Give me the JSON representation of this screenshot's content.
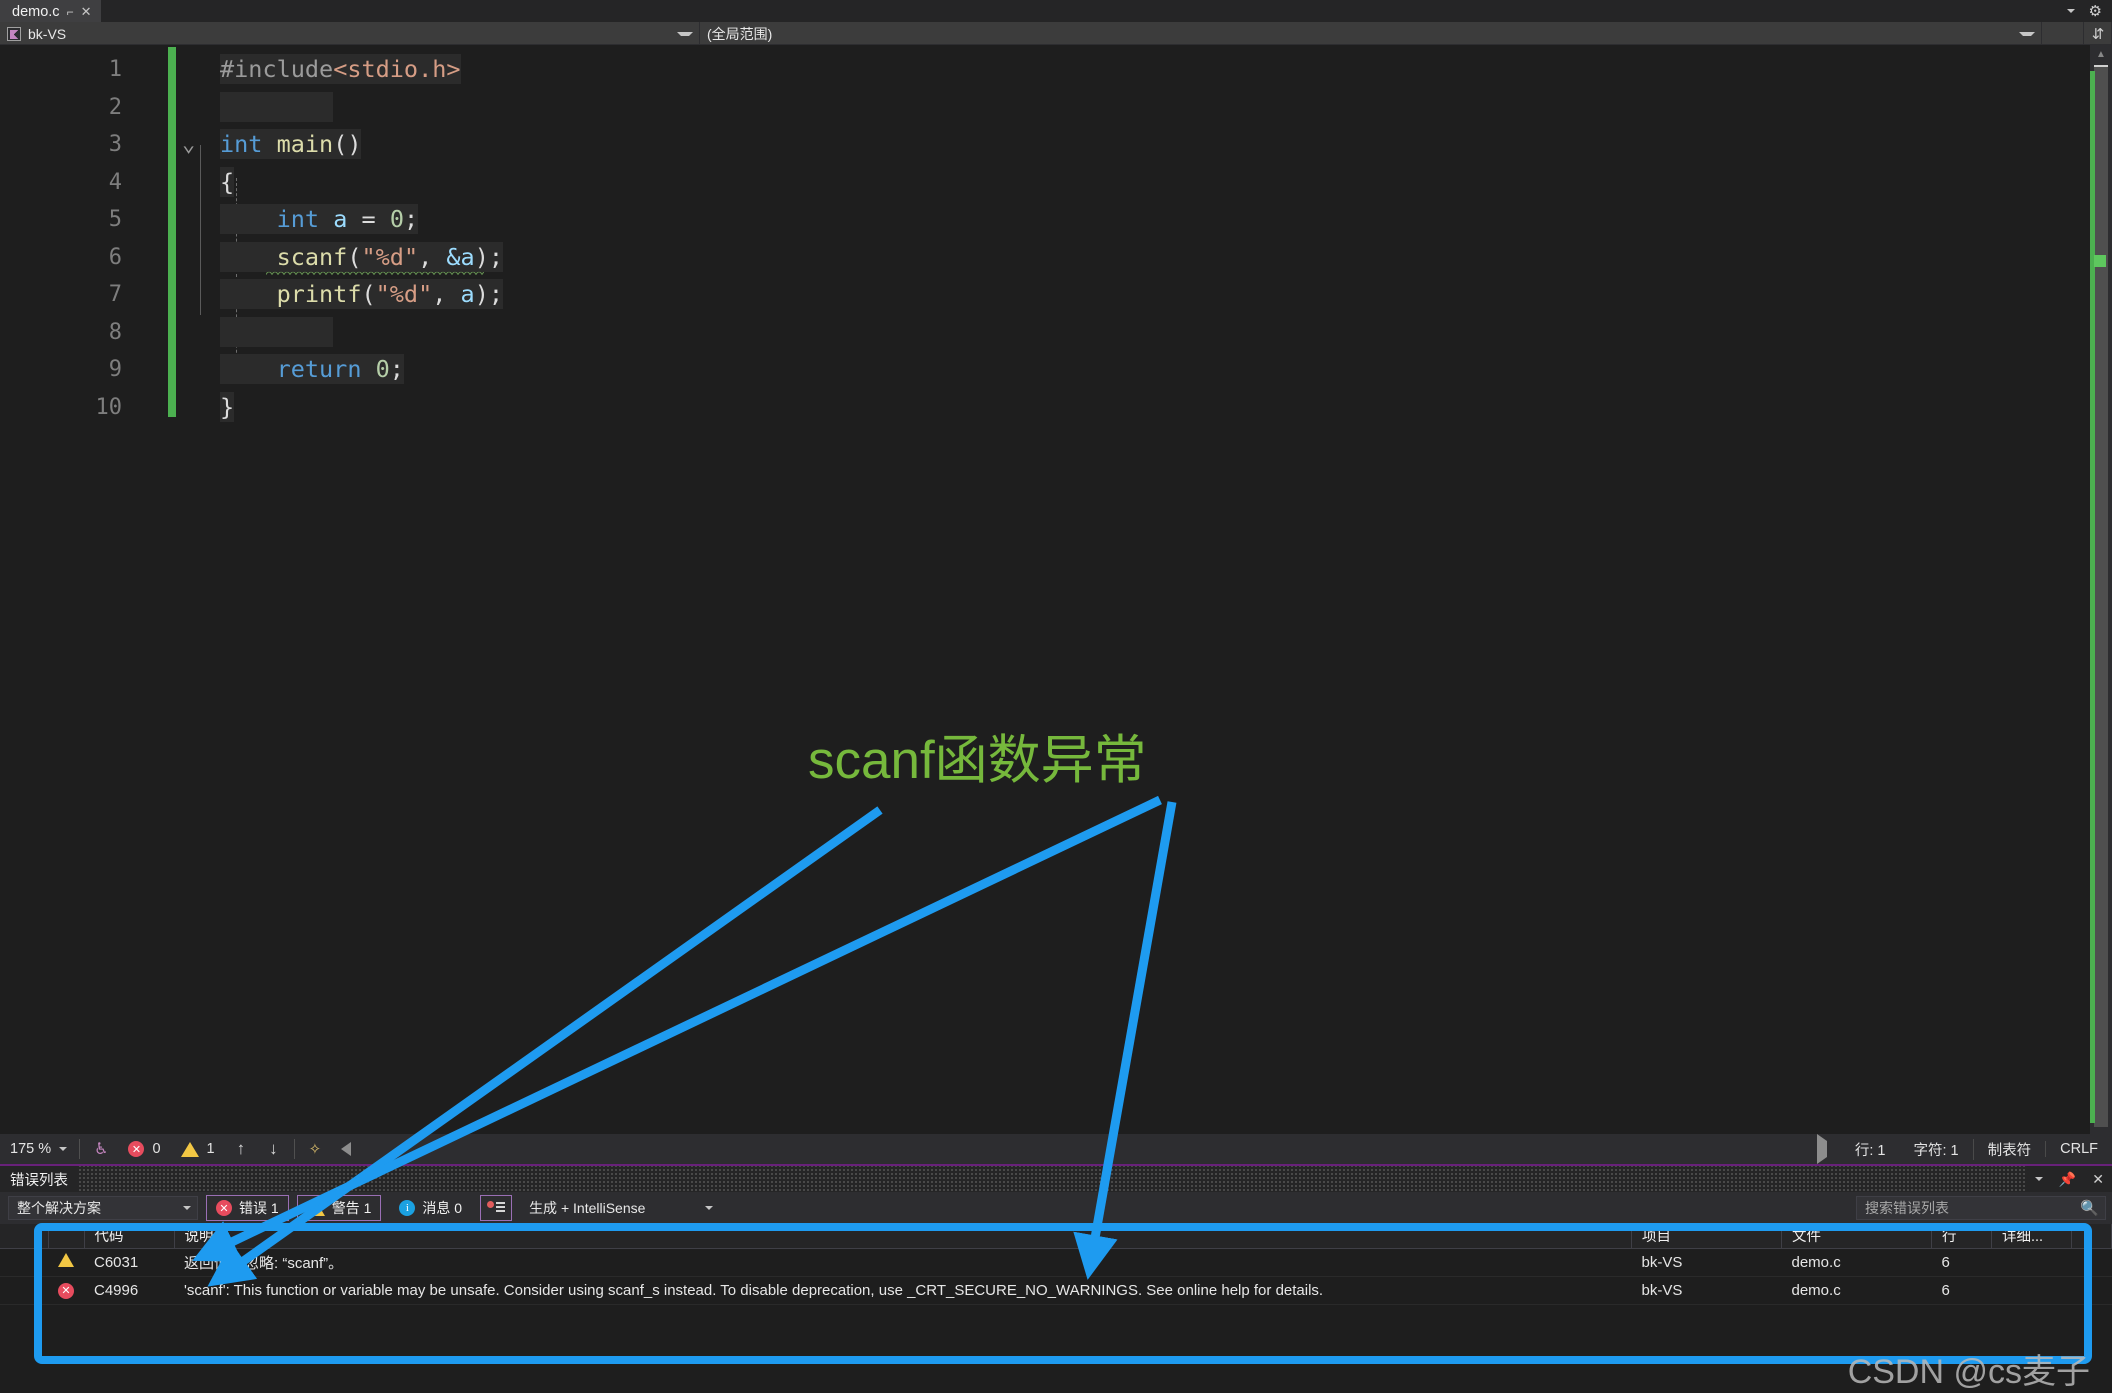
{
  "window": {
    "tab": {
      "title": "demo.c",
      "pin_icon": "pin-icon",
      "close_icon": "close-icon"
    },
    "gear_icon": "gear-icon",
    "split_icon": "split-view-icon"
  },
  "navbar": {
    "project": "bk-VS",
    "scope": "(全局范围)",
    "project_icon": "project-icon",
    "dropdown_icon": "chevron-down-icon"
  },
  "editor": {
    "line_numbers": [
      "1",
      "2",
      "3",
      "4",
      "5",
      "6",
      "7",
      "8",
      "9",
      "10"
    ],
    "code_lines": [
      {
        "n": 1,
        "tokens": [
          {
            "t": "#include",
            "c": "pp"
          },
          {
            "t": "<stdio.h>",
            "c": "hdr"
          }
        ]
      },
      {
        "n": 2,
        "tokens": []
      },
      {
        "n": 3,
        "tokens": [
          {
            "t": "int ",
            "c": "kw"
          },
          {
            "t": "main",
            "c": "fn"
          },
          {
            "t": "()",
            "c": "plain"
          }
        ]
      },
      {
        "n": 4,
        "tokens": [
          {
            "t": "{",
            "c": "plain"
          }
        ]
      },
      {
        "n": 5,
        "tokens": [
          {
            "t": "    ",
            "c": "plain"
          },
          {
            "t": "int",
            "c": "kw"
          },
          {
            "t": " ",
            "c": "plain"
          },
          {
            "t": "a",
            "c": "var"
          },
          {
            "t": " = ",
            "c": "plain"
          },
          {
            "t": "0",
            "c": "num"
          },
          {
            "t": ";",
            "c": "plain"
          }
        ]
      },
      {
        "n": 6,
        "tokens": [
          {
            "t": "    ",
            "c": "plain"
          },
          {
            "t": "scanf",
            "c": "fn"
          },
          {
            "t": "(",
            "c": "plain"
          },
          {
            "t": "\"%d\"",
            "c": "str"
          },
          {
            "t": ", ",
            "c": "plain"
          },
          {
            "t": "&a",
            "c": "var"
          },
          {
            "t": ");",
            "c": "plain"
          }
        ]
      },
      {
        "n": 7,
        "tokens": [
          {
            "t": "    ",
            "c": "plain"
          },
          {
            "t": "printf",
            "c": "fn"
          },
          {
            "t": "(",
            "c": "plain"
          },
          {
            "t": "\"%d\"",
            "c": "str"
          },
          {
            "t": ", ",
            "c": "plain"
          },
          {
            "t": "a",
            "c": "var"
          },
          {
            "t": ");",
            "c": "plain"
          }
        ]
      },
      {
        "n": 8,
        "tokens": []
      },
      {
        "n": 9,
        "tokens": [
          {
            "t": "    ",
            "c": "plain"
          },
          {
            "t": "return",
            "c": "kw"
          },
          {
            "t": " ",
            "c": "plain"
          },
          {
            "t": "0",
            "c": "num"
          },
          {
            "t": ";",
            "c": "plain"
          }
        ]
      },
      {
        "n": 10,
        "tokens": [
          {
            "t": "}",
            "c": "plain"
          }
        ]
      }
    ],
    "squiggle_line": 6,
    "fold_line": 3,
    "fold_icon": "chevron-down-icon",
    "change_bar_color": "#4cb050"
  },
  "editor_status": {
    "zoom": "175 %",
    "zoom_caret_icon": "chevron-down-icon",
    "intellisense_icon": "intellisense-icon",
    "error_count": "0",
    "warning_count": "1",
    "prev_icon": "arrow-up-icon",
    "next_icon": "arrow-down-icon",
    "tools_icon": "tools-icon",
    "collapse_icon": "triangle-left-icon",
    "expand_icon": "triangle-right-icon",
    "line_label": "行: 1",
    "char_label": "字符: 1",
    "tab_label": "制表符",
    "eol_label": "CRLF"
  },
  "error_panel": {
    "title": "错误列表",
    "dropdown_icon": "chevron-down-icon",
    "pin_icon": "pin-icon",
    "close_icon": "close-icon",
    "scope_filter": "整个解决方案",
    "errors_label": "错误 1",
    "warnings_label": "警告 1",
    "messages_label": "消息 0",
    "build_filter": "生成 + IntelliSense",
    "search_placeholder": "搜索错误列表",
    "search_icon": "search-icon",
    "filter_icon": "filter-icon",
    "columns": [
      "",
      "",
      "代码",
      "说明",
      "项目",
      "文件",
      "行",
      "详细...",
      ""
    ],
    "rows": [
      {
        "severity": "warning",
        "severity_icon": "warning-triangle-icon",
        "code": "C6031",
        "description": "返回值被忽略: “scanf”。",
        "project": "bk-VS",
        "file": "demo.c",
        "line": "6",
        "details": ""
      },
      {
        "severity": "error",
        "severity_icon": "error-circle-icon",
        "code": "C4996",
        "description": "'scanf': This function or variable may be unsafe. Consider using scanf_s instead. To disable deprecation, use _CRT_SECURE_NO_WARNINGS. See online help for details.",
        "project": "bk-VS",
        "file": "demo.c",
        "line": "6",
        "details": ""
      }
    ]
  },
  "annotations": {
    "label": "scanf函数异常",
    "label_color": "#76b83c",
    "arrow_color": "#1e9bf0",
    "highlight_box_color": "#1e9bf0",
    "watermark": "CSDN @cs麦子"
  }
}
